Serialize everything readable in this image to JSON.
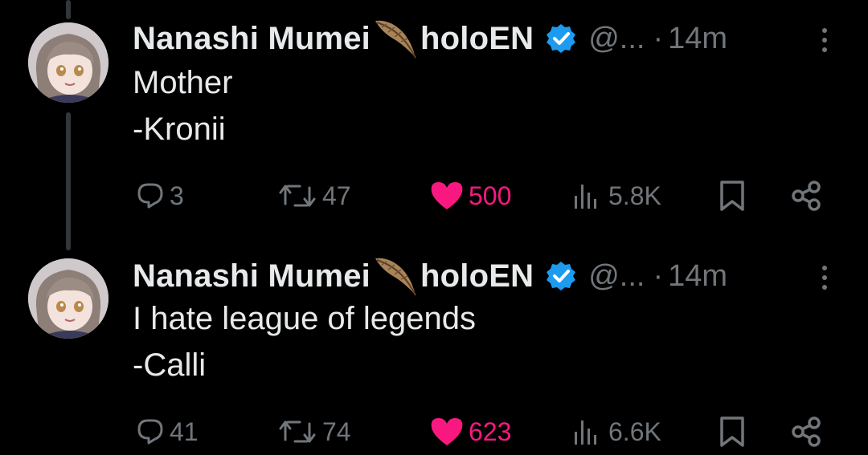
{
  "tweets": [
    {
      "author_name": "Nanashi Mumei",
      "author_suffix": "holoEN",
      "handle": "@...",
      "separator": "·",
      "time": "14m",
      "lines": [
        "Mother",
        "-Kronii"
      ],
      "replies": "3",
      "reposts": "47",
      "likes": "500",
      "liked": true,
      "views": "5.8K"
    },
    {
      "author_name": "Nanashi Mumei",
      "author_suffix": "holoEN",
      "handle": "@...",
      "separator": "·",
      "time": "14m",
      "lines": [
        "I hate league of legends",
        "-Calli"
      ],
      "replies": "41",
      "reposts": "74",
      "likes": "623",
      "liked": true,
      "views": "6.6K"
    }
  ],
  "icons": {
    "reply": "reply-icon",
    "repost": "repost-icon",
    "like": "heart-icon",
    "views": "views-icon",
    "bookmark": "bookmark-icon",
    "share": "share-icon",
    "verified": "verified-badge-icon",
    "feather": "feather-icon",
    "more": "more-options-icon"
  },
  "colors": {
    "background": "#000000",
    "primary_text": "#e7e9ea",
    "secondary_text": "#71767b",
    "like_pink": "#f91880",
    "verified_blue": "#1d9bf0",
    "thread_line": "#333639"
  }
}
